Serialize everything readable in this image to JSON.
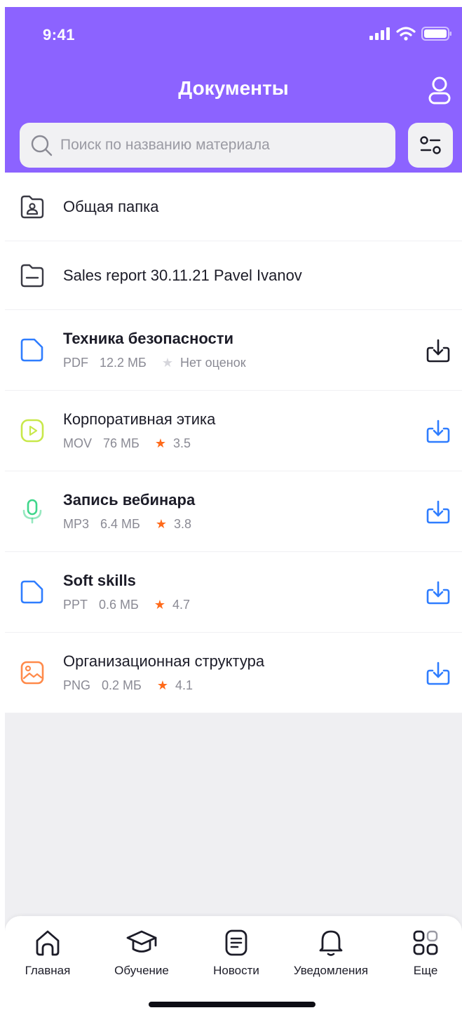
{
  "status_bar": {
    "time": "9:41"
  },
  "header": {
    "title": "Документы"
  },
  "search": {
    "placeholder": "Поиск по названию материала",
    "value": ""
  },
  "colors": {
    "header": "#8c63ff",
    "accent_blue": "#2f7dff",
    "star": "#ff6a1a",
    "star_empty": "#d6d6dc"
  },
  "folders": [
    {
      "name": "Общая папка",
      "icon": "shared-folder-icon"
    },
    {
      "name": "Sales report 30.11.21 Pavel Ivanov",
      "icon": "folder-icon"
    }
  ],
  "files": [
    {
      "name": "Техника безопасности",
      "type": "PDF",
      "size": "12.2 МБ",
      "rating": "Нет оценок",
      "rated": false,
      "unread": true,
      "icon": "document-icon",
      "downloaded": true
    },
    {
      "name": "Корпоративная этика",
      "type": "MOV",
      "size": "76 МБ",
      "rating": "3.5",
      "rated": true,
      "unread": false,
      "icon": "video-icon",
      "downloaded": false
    },
    {
      "name": "Запись вебинара",
      "type": "MP3",
      "size": "6.4 МБ",
      "rating": "3.8",
      "rated": true,
      "unread": true,
      "icon": "microphone-icon",
      "downloaded": false
    },
    {
      "name": "Soft skills",
      "type": "PPT",
      "size": "0.6 МБ",
      "rating": "4.7",
      "rated": true,
      "unread": true,
      "icon": "document-icon",
      "downloaded": false
    },
    {
      "name": "Организационная структура",
      "type": "PNG",
      "size": "0.2 МБ",
      "rating": "4.1",
      "rated": true,
      "unread": false,
      "icon": "image-icon",
      "downloaded": false
    }
  ],
  "tabbar": [
    {
      "label": "Главная",
      "icon": "home-icon"
    },
    {
      "label": "Обучение",
      "icon": "graduation-cap-icon"
    },
    {
      "label": "Новости",
      "icon": "news-icon"
    },
    {
      "label": "Уведомления",
      "icon": "bell-icon"
    },
    {
      "label": "Еще",
      "icon": "more-grid-icon"
    }
  ]
}
